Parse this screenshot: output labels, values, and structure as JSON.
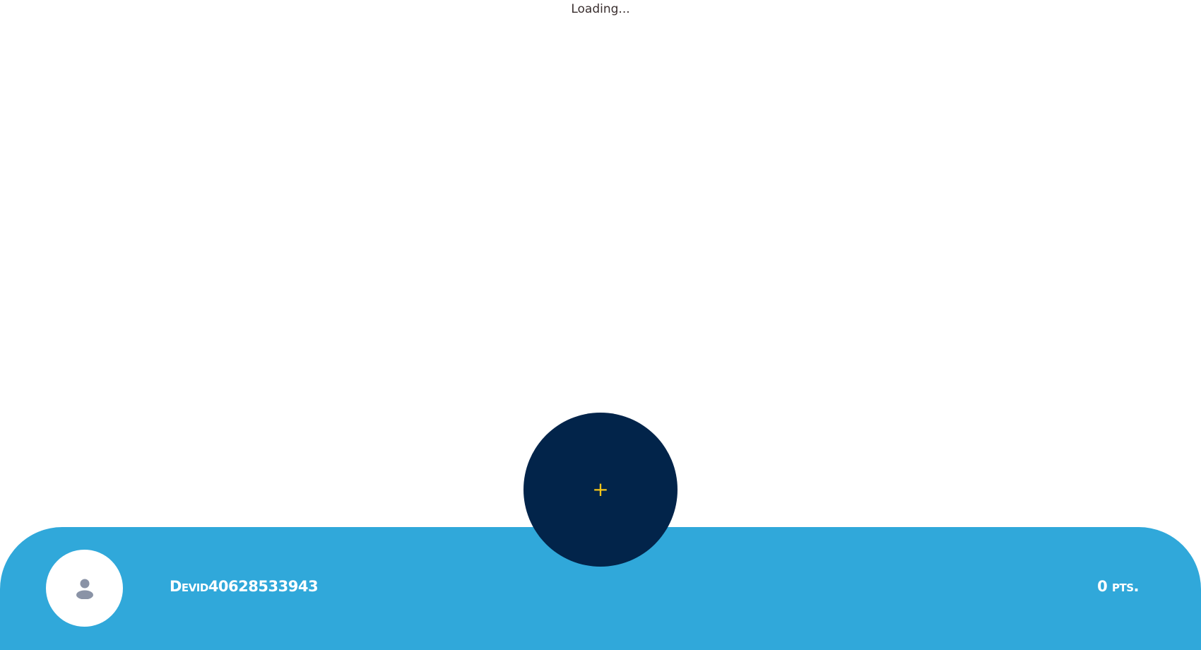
{
  "status": {
    "loading_text": "Loading..."
  },
  "fab": {
    "label": "+",
    "icon": "plus-icon",
    "background": "#02244a",
    "icon_color": "#f5c518"
  },
  "footer": {
    "background": "#30a8da",
    "username": "Devid40628533943",
    "points": "0 pts.",
    "avatar_icon": "user-icon"
  }
}
